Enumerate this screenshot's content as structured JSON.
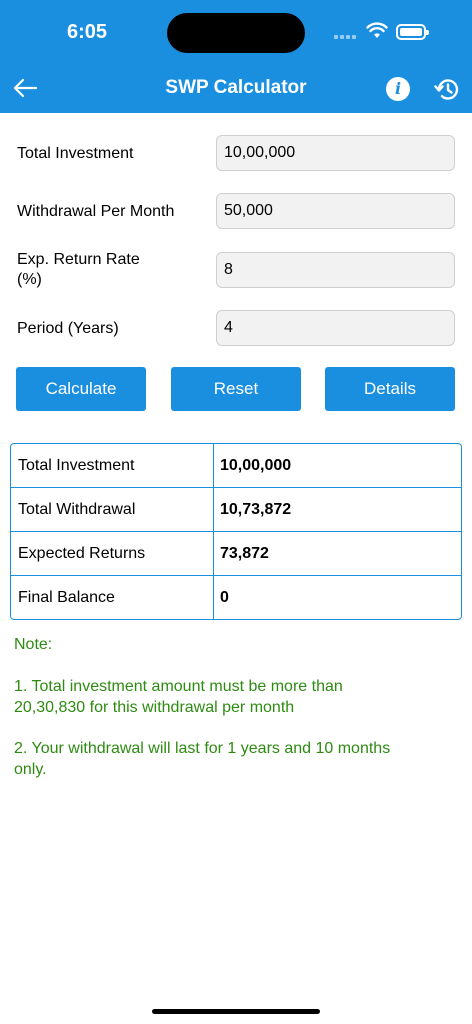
{
  "status_bar": {
    "time": "6:05"
  },
  "header": {
    "title": "SWP Calculator",
    "back_icon": "arrow-left-icon",
    "info_icon": "info-icon",
    "info_glyph": "i",
    "history_icon": "history-icon",
    "accent_color": "#1a8fe0"
  },
  "form": {
    "fields": [
      {
        "label": "Total Investment",
        "value": "10,00,000"
      },
      {
        "label": "Withdrawal Per Month",
        "value": "50,000"
      },
      {
        "label": "Exp. Return Rate (%)",
        "value": "8"
      },
      {
        "label": "Period (Years)",
        "value": "4"
      }
    ]
  },
  "buttons": {
    "calculate": "Calculate",
    "reset": "Reset",
    "details": "Details"
  },
  "results": {
    "rows": [
      {
        "label": "Total Investment",
        "value": "10,00,000"
      },
      {
        "label": "Total Withdrawal",
        "value": "10,73,872"
      },
      {
        "label": "Expected Returns",
        "value": "73,872"
      },
      {
        "label": "Final Balance",
        "value": "0"
      }
    ]
  },
  "note": {
    "title": "Note:",
    "items": [
      "1. Total investment amount must be more than 20,30,830 for this withdrawal per month",
      "2. Your withdrawal will last for 1 years and 10 months only."
    ],
    "color": "#2e8b12"
  }
}
